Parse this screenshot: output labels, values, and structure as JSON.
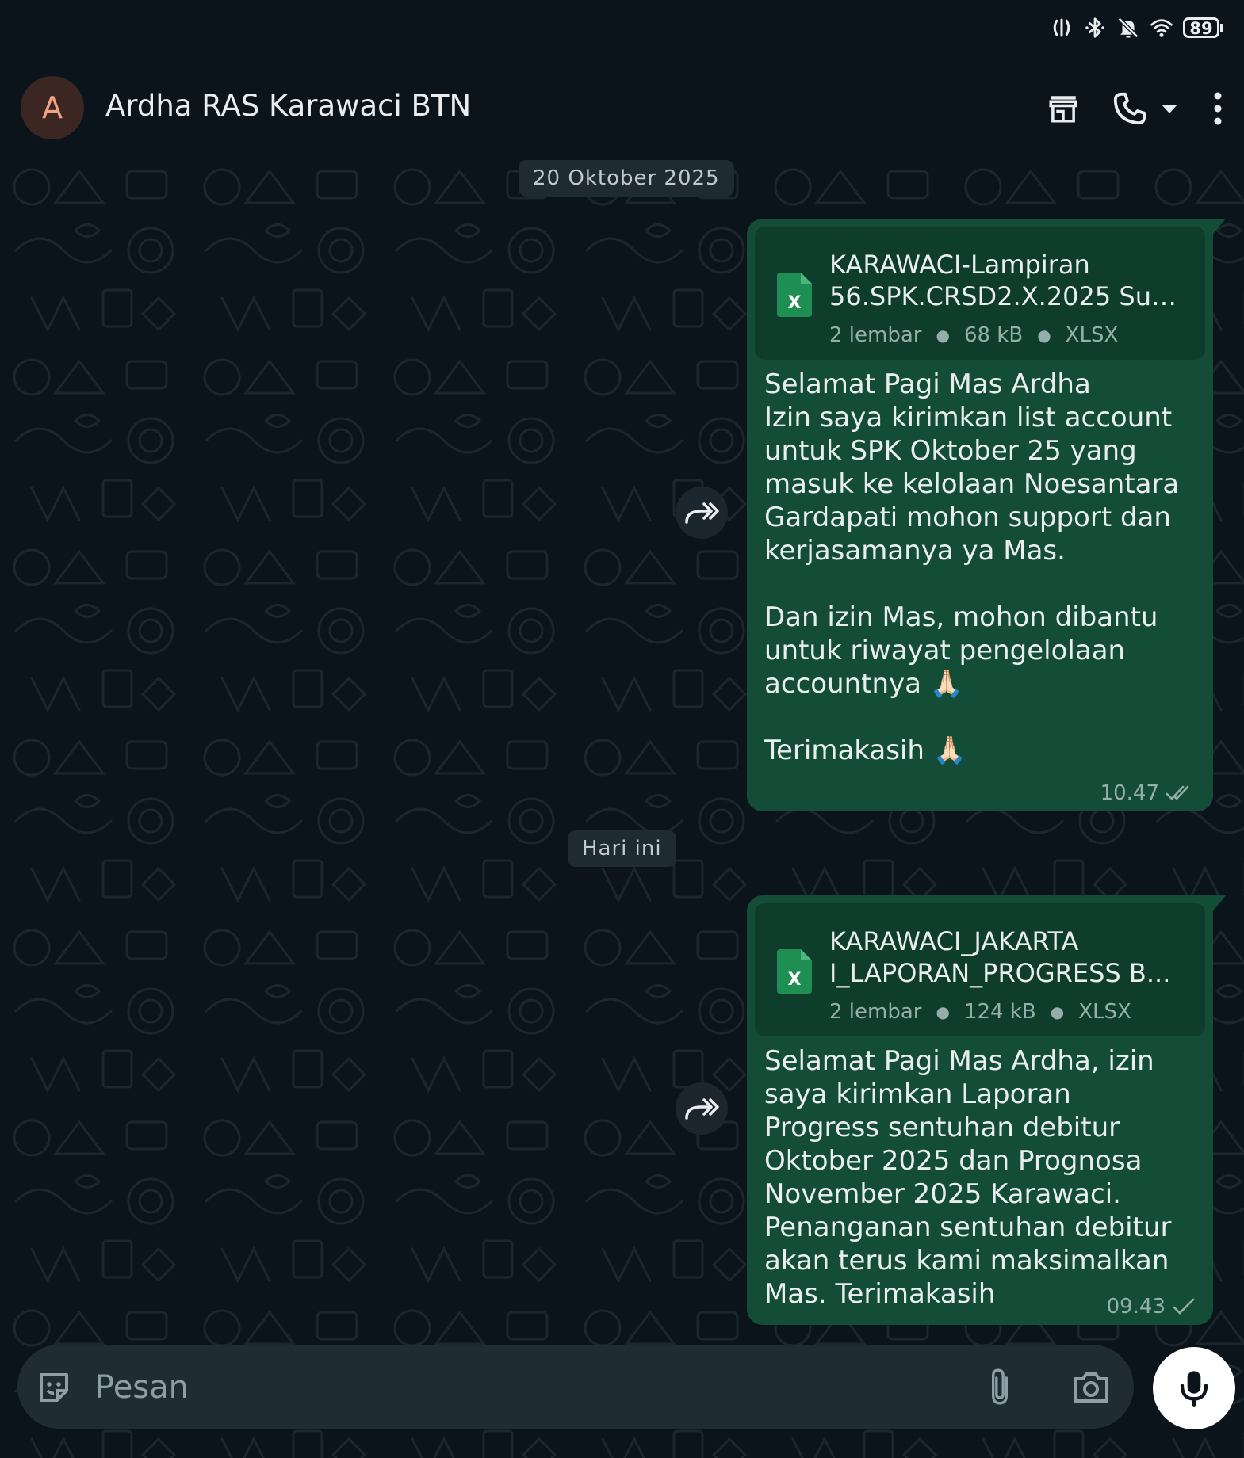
{
  "status_bar": {
    "icons": [
      "nfc-icon",
      "bluetooth-icon",
      "bell-off-icon",
      "wifi-icon"
    ],
    "battery_level": "89"
  },
  "header": {
    "avatar_letter": "A",
    "contact_name": "Ardha RAS Karawaci BTN",
    "icons": [
      "shop-icon",
      "phone-icon",
      "caret-down-icon",
      "more-vertical-icon"
    ]
  },
  "colors": {
    "background": "#0b141a",
    "outgoing_bubble": "#144d37",
    "document_card": "#0f3d2b",
    "date_chip": "#1e2b33",
    "read_ticks": "#96aeab",
    "excel_green": "#1e8e52"
  },
  "chat": {
    "date_chips": [
      "20 Oktober 2025",
      "Hari ini"
    ],
    "messages": [
      {
        "direction": "outgoing",
        "document": {
          "name_line1": "KARAWACI-Lampiran",
          "name_line2": "56.SPK.CRSD2.X.2025 Sur...",
          "pages": "2 lembar",
          "size": "68 kB",
          "type": "XLSX",
          "icon": "excel-file-icon"
        },
        "text": "Selamat Pagi Mas Ardha\nIzin saya kirimkan list account untuk SPK Oktober 25 yang masuk ke kelolaan Noesantara Gardapati mohon support dan kerjasamanya ya Mas.\n\nDan izin Mas, mohon dibantu untuk riwayat pengelolaan accountnya 🙏🏻\n\nTerimakasih 🙏🏻",
        "time": "10.47",
        "status": "read"
      },
      {
        "direction": "outgoing",
        "document": {
          "name_line1": "KARAWACI_JAKARTA",
          "name_line2": "I_LAPORAN_PROGRESS B...",
          "pages": "2 lembar",
          "size": "124 kB",
          "type": "XLSX",
          "icon": "excel-file-icon"
        },
        "text": "Selamat Pagi Mas Ardha, izin saya kirimkan Laporan Progress sentuhan debitur Oktober 2025 dan Prognosa November 2025 Karawaci. Penanganan sentuhan debitur akan terus kami maksimalkan Mas. Terimakasih",
        "time": "09.43",
        "status": "sent"
      }
    ]
  },
  "composer": {
    "placeholder": "Pesan",
    "icons": [
      "emoji-icon",
      "paperclip-icon",
      "camera-icon",
      "microphone-icon"
    ]
  }
}
